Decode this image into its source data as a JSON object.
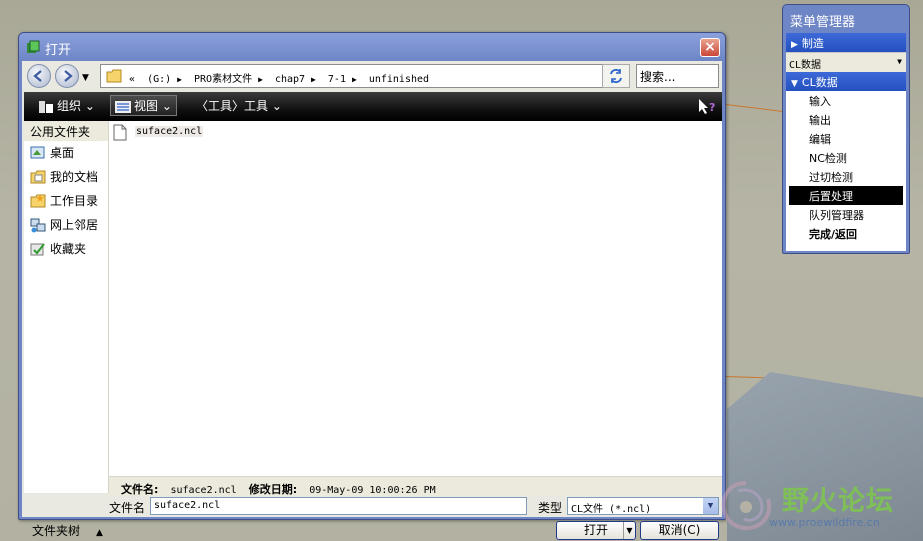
{
  "dialog": {
    "title": "打开",
    "close_label": "×"
  },
  "address": {
    "path": [
      "«",
      "(G:)",
      "PRO素材文件",
      "chap7",
      "7-1",
      "unfinished"
    ],
    "search_placeholder": "搜索..."
  },
  "toolbar": {
    "organize_label": "组织",
    "views_label": "视图",
    "tools_label": "〈工具〉工具"
  },
  "sidebar": {
    "header": "公用文件夹",
    "items": [
      {
        "label": "桌面",
        "icon": "desktop-icon"
      },
      {
        "label": "我的文档",
        "icon": "my-documents-icon"
      },
      {
        "label": "工作目录",
        "icon": "working-directory-icon"
      },
      {
        "label": "网上邻居",
        "icon": "network-icon"
      },
      {
        "label": "收藏夹",
        "icon": "favorites-icon"
      }
    ]
  },
  "files": [
    {
      "name": "suface2.ncl",
      "icon": "file-icon"
    }
  ],
  "details": {
    "filename_label": "文件名:",
    "filename_value": "suface2.ncl",
    "modified_label": "修改日期:",
    "modified_value": "09-May-09 10:00:26 PM"
  },
  "bottom": {
    "filename_label": "文件名",
    "filename_value": "suface2.ncl",
    "type_label": "类型",
    "type_value": "CL文件 (*.ncl)",
    "folder_tree_label": "文件夹树",
    "open_label": "打开",
    "cancel_label": "取消(C)"
  },
  "menu_manager": {
    "title": "菜单管理器",
    "manufacture_label": "制造",
    "dropdown_value": "CL数据",
    "cl_section_label": "CL数据",
    "items": [
      "输入",
      "输出",
      "编辑",
      "NC检测",
      "过切检测",
      "后置处理",
      "队列管理器",
      "完成/返回"
    ],
    "selected_item": "后置处理"
  },
  "watermark": {
    "text": "野火论坛",
    "url": "www.proewildfire.cn"
  },
  "colors": {
    "title_bar": "#6f86c6",
    "menu_section": "#2f5bd0",
    "toolbar": "#111111",
    "selected_bg": "#000000"
  }
}
